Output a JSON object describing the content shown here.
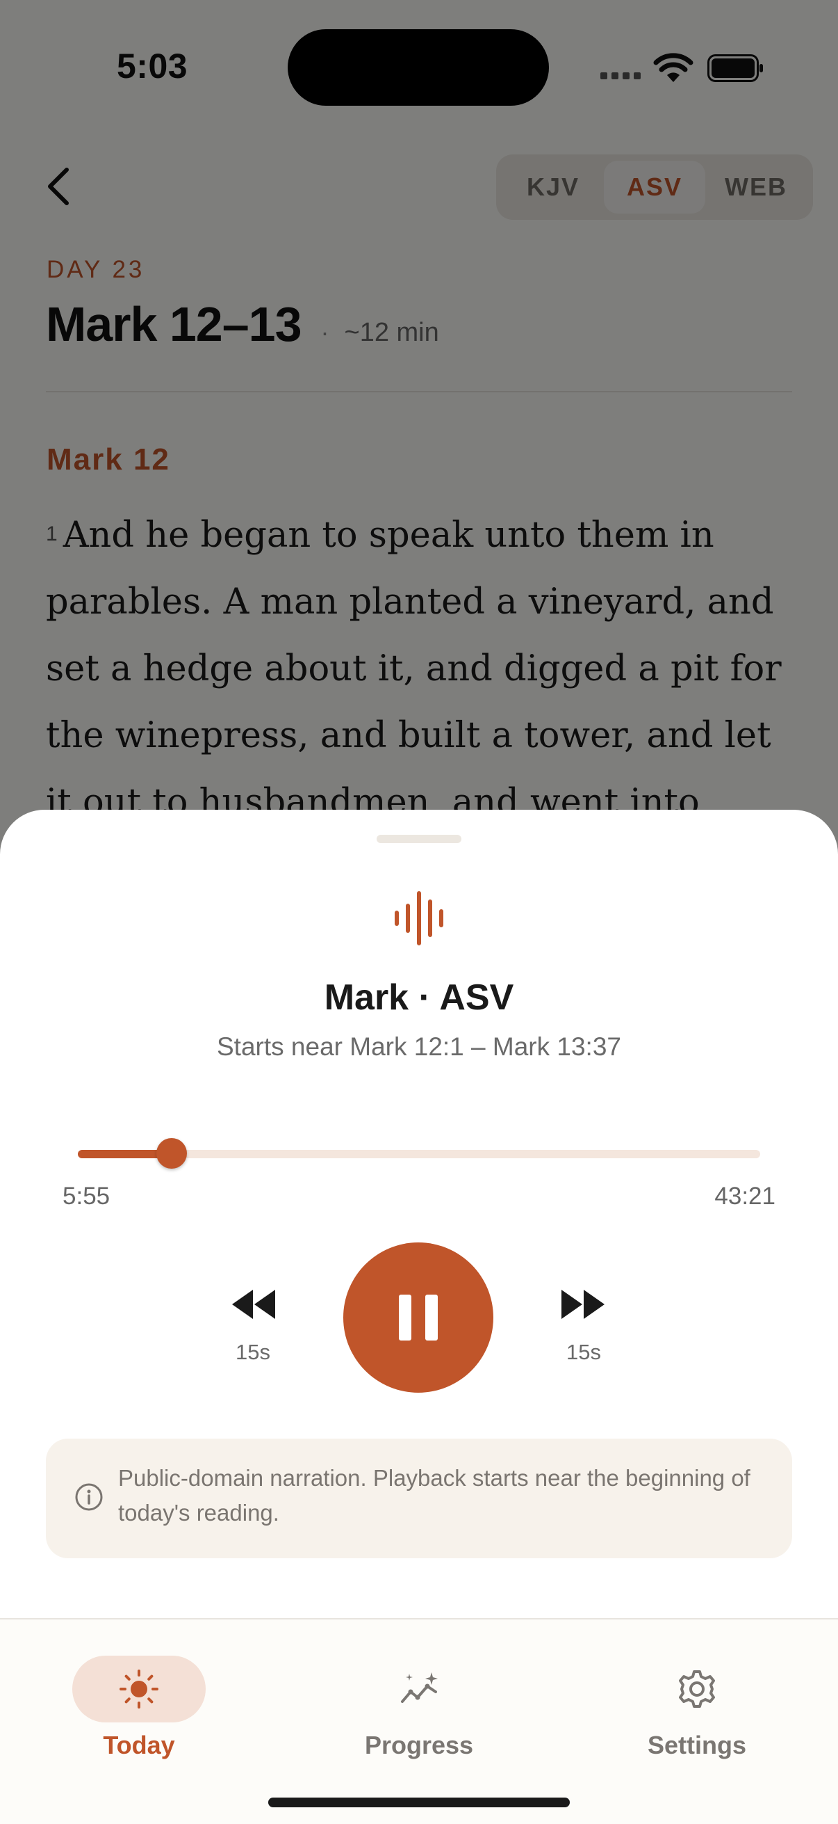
{
  "status_bar": {
    "time": "5:03"
  },
  "translations": {
    "options": [
      "KJV",
      "ASV",
      "WEB"
    ],
    "selected": "ASV"
  },
  "reading": {
    "day_label": "DAY 23",
    "title": "Mark 12–13",
    "separator": "·",
    "duration": "~12 min",
    "chapter_label": "Mark 12",
    "verse_number": "1",
    "verse_text": "And he began to speak unto them in parables. A man planted a vineyard, and set a hedge about it, and digged a pit for the winepress, and built a tower, and let it out to husbandmen, and went into another"
  },
  "player": {
    "icon": "audio-waveform-icon",
    "title": "Mark · ASV",
    "subtitle": "Starts near Mark 12:1 – Mark 13:37",
    "elapsed": "5:55",
    "total": "43:21",
    "progress": 0.137,
    "skip_back_label": "15s",
    "skip_forward_label": "15s",
    "note": "Public-domain narration. Playback starts near the beginning of today's reading."
  },
  "tabs": [
    {
      "label": "Today",
      "icon": "sun-icon",
      "active": true
    },
    {
      "label": "Progress",
      "icon": "sparkle-chart-icon",
      "active": false
    },
    {
      "label": "Settings",
      "icon": "gear-icon",
      "active": false
    }
  ],
  "colors": {
    "accent": "#c0552a",
    "accent_soft": "#f4e0d6",
    "note_bg": "#f7f2eb"
  }
}
